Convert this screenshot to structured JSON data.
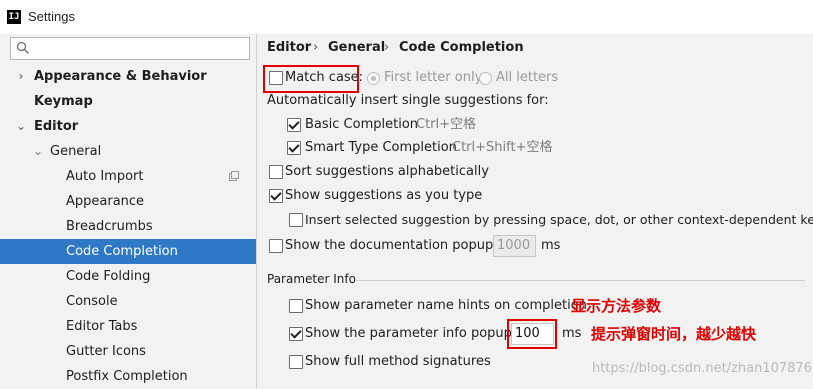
{
  "window": {
    "title": "Settings",
    "app_icon": "IJ"
  },
  "search": {
    "placeholder": "",
    "value": "",
    "icon": "search-icon"
  },
  "sidebar": {
    "items": [
      {
        "label": "Appearance & Behavior",
        "chevron": "›"
      },
      {
        "label": "Keymap"
      },
      {
        "label": "Editor",
        "chevron": "⌄"
      },
      {
        "label": "General",
        "chevron": "⌄"
      },
      {
        "label": "Auto Import"
      },
      {
        "label": "Appearance"
      },
      {
        "label": "Breadcrumbs"
      },
      {
        "label": "Code Completion",
        "selected": true
      },
      {
        "label": "Code Folding"
      },
      {
        "label": "Console"
      },
      {
        "label": "Editor Tabs"
      },
      {
        "label": "Gutter Icons"
      },
      {
        "label": "Postfix Completion"
      }
    ]
  },
  "breadcrumb": {
    "items": [
      "Editor",
      "General",
      "Code Completion"
    ],
    "separator": "›"
  },
  "options": {
    "match_case": {
      "label": "Match case:",
      "checked": false
    },
    "first_letter_only": {
      "label": "First letter only",
      "selected": true
    },
    "all_letters": {
      "label": "All letters",
      "selected": false
    },
    "auto_insert_header": "Automatically insert single suggestions for:",
    "basic_completion": {
      "label": "Basic Completion",
      "shortcut": "Ctrl+空格",
      "checked": true
    },
    "smart_type_completion": {
      "label": "Smart Type Completion",
      "shortcut": "Ctrl+Shift+空格",
      "checked": true
    },
    "sort_alphabetically": {
      "label": "Sort suggestions alphabetically",
      "checked": false
    },
    "show_as_you_type": {
      "label": "Show suggestions as you type",
      "checked": true
    },
    "insert_selected": {
      "label": "Insert selected suggestion by pressing space, dot, or other context-dependent keys",
      "checked": false
    },
    "doc_popup": {
      "label": "Show the documentation popup in",
      "value": "1000",
      "unit": "ms",
      "checked": false
    }
  },
  "parameter_info": {
    "section_label": "Parameter Info",
    "name_hints": {
      "label": "Show parameter name hints on completion",
      "checked": false
    },
    "info_popup": {
      "label": "Show the parameter info popup in",
      "value": "100",
      "unit": "ms",
      "checked": true
    },
    "full_signatures": {
      "label": "Show full method signatures",
      "checked": false
    }
  },
  "annotations": {
    "name_hints_note": "显示方法参数",
    "popup_note": "提示弹窗时间，越少越快",
    "color": "#e00000"
  },
  "watermark": "https://blog.csdn.net/zhan107876",
  "colors": {
    "selection": "#2f78c6",
    "background": "#f2f2f2"
  }
}
